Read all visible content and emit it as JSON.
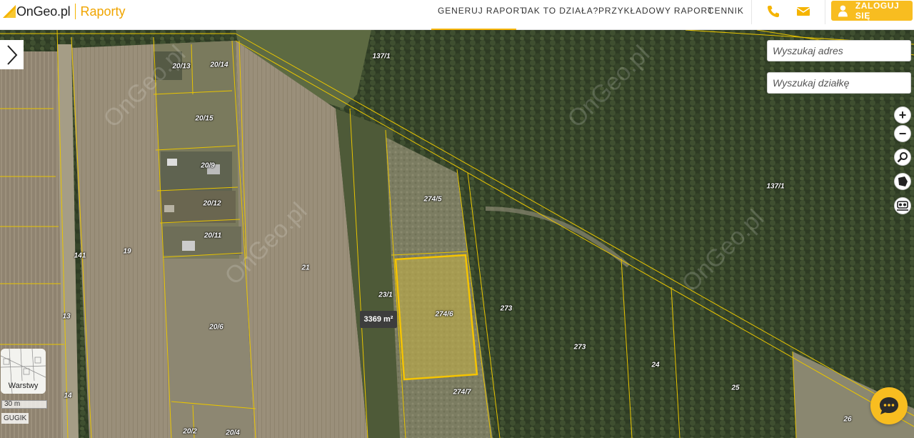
{
  "header": {
    "logo_name": "OnGeo.pl",
    "logo_product": "Raporty",
    "nav": [
      {
        "label": "GENERUJ RAPORT",
        "active": true
      },
      {
        "label": "JAK TO DZIAŁA?",
        "active": false
      },
      {
        "label": "PRZYKŁADOWY RAPORT",
        "active": false
      },
      {
        "label": "CENNIK",
        "active": false
      }
    ],
    "phone_icon": "phone-icon",
    "mail_icon": "mail-icon",
    "login_label": "ZALOGUJ SIĘ"
  },
  "search": {
    "address_placeholder": "Wyszukaj adres",
    "parcel_placeholder": "Wyszukaj działkę"
  },
  "map_controls": {
    "zoom_in": "+",
    "zoom_out": "−",
    "icons": [
      "zoom-in-icon",
      "zoom-out-icon",
      "magnifier-icon",
      "polygon-icon",
      "street-view-icon"
    ]
  },
  "selected_parcel": {
    "id": "274/6",
    "area": "3369 m²"
  },
  "parcel_labels": [
    {
      "id": "pl-20-13",
      "text": "20/13"
    },
    {
      "id": "pl-20-14",
      "text": "20/14"
    },
    {
      "id": "pl-137-1-a",
      "text": "137/1"
    },
    {
      "id": "pl-20-15",
      "text": "20/15"
    },
    {
      "id": "pl-20-9",
      "text": "20/9"
    },
    {
      "id": "pl-20-12",
      "text": "20/12"
    },
    {
      "id": "pl-20-11",
      "text": "20/11"
    },
    {
      "id": "pl-274-5",
      "text": "274/5"
    },
    {
      "id": "pl-137-1-b",
      "text": "137/1"
    },
    {
      "id": "pl-141",
      "text": "141"
    },
    {
      "id": "pl-19",
      "text": "19"
    },
    {
      "id": "pl-21",
      "text": "21"
    },
    {
      "id": "pl-23-1",
      "text": "23/1"
    },
    {
      "id": "pl-274-6",
      "text": "274/6"
    },
    {
      "id": "pl-273-a",
      "text": "273"
    },
    {
      "id": "pl-13",
      "text": "13"
    },
    {
      "id": "pl-20-6",
      "text": "20/6"
    },
    {
      "id": "pl-273-b",
      "text": "273"
    },
    {
      "id": "pl-24",
      "text": "24"
    },
    {
      "id": "pl-25",
      "text": "25"
    },
    {
      "id": "pl-274-7",
      "text": "274/7"
    },
    {
      "id": "pl-14",
      "text": "14"
    },
    {
      "id": "pl-26",
      "text": "26"
    },
    {
      "id": "pl-20-2",
      "text": "20/2"
    },
    {
      "id": "pl-20-4",
      "text": "20/4"
    }
  ],
  "watermark_text": "OnGeo.pl",
  "layers_label": "Warstwy",
  "scale_label": "30 m",
  "attribution": "GUGIK",
  "colors": {
    "accent": "#f8bd20",
    "parcel_line": "#e8c400",
    "selected_fill": "#c9b445"
  }
}
